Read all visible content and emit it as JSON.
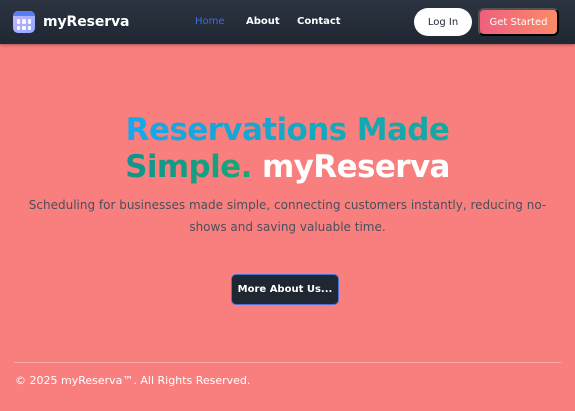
{
  "brand": {
    "name": "myReserva",
    "logo_icon": "calendar-icon"
  },
  "nav": {
    "links": [
      {
        "label": "Home",
        "active": true
      },
      {
        "label": "About",
        "active": false
      },
      {
        "label": "Contact",
        "active": false
      }
    ],
    "login_label": "Log In",
    "cta_label": "Get Started"
  },
  "hero": {
    "title_line1": "Reservations Made",
    "title_simple": "Simple.",
    "title_brand": "myReserva",
    "subtitle": "Scheduling for businesses made simple, connecting customers instantly, reducing no-shows and saving valuable time.",
    "button_label": "More About Us..."
  },
  "footer": {
    "copyright": "© 2025 myReserva™. All Rights Reserved."
  },
  "colors": {
    "page_background": "#f97f7e",
    "navbar": "#1f2733",
    "active_link": "#3d6af2",
    "cta_gradient_start": "#f0607e",
    "cta_gradient_end": "#fb8a67",
    "title_blue": "#17a7ef",
    "title_teal": "#13a8a0"
  }
}
